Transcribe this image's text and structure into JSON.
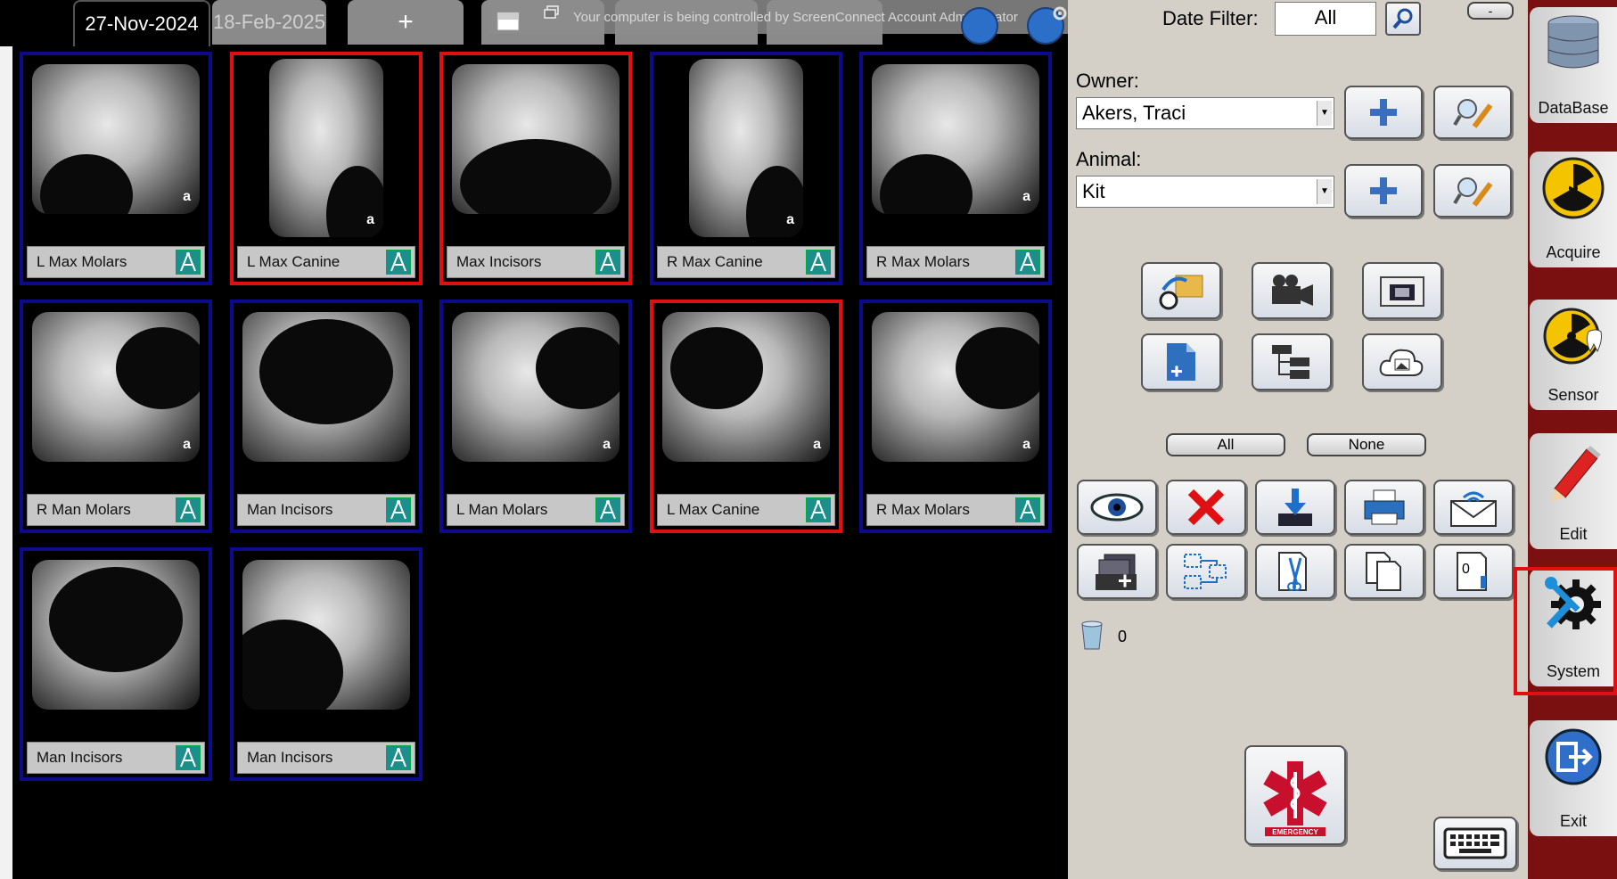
{
  "tabs": {
    "active": "27-Nov-2024",
    "inactive": "18-Feb-2025",
    "add": "+"
  },
  "screenconnect": {
    "banner": "Your computer is being controlled by ScreenConnect Account Administrator"
  },
  "thumbnails": [
    {
      "label": "L Max Molars",
      "selected": false,
      "mark": "a"
    },
    {
      "label": "L Max Canine",
      "selected": true,
      "mark": "a"
    },
    {
      "label": "Max Incisors",
      "selected": true,
      "mark": ""
    },
    {
      "label": "R Max Canine",
      "selected": false,
      "mark": "a"
    },
    {
      "label": "R Max Molars",
      "selected": false,
      "mark": "a"
    },
    {
      "label": "R Man Molars",
      "selected": false,
      "mark": "a"
    },
    {
      "label": "Man Incisors",
      "selected": false,
      "mark": ""
    },
    {
      "label": "L Man Molars",
      "selected": false,
      "mark": "a"
    },
    {
      "label": "L Max Canine",
      "selected": true,
      "mark": "a"
    },
    {
      "label": "R Max Molars",
      "selected": false,
      "mark": "a"
    },
    {
      "label": "Man Incisors",
      "selected": false,
      "mark": ""
    },
    {
      "label": "Man Incisors",
      "selected": false,
      "mark": ""
    }
  ],
  "panel": {
    "date_filter_label": "Date Filter:",
    "date_filter_value": "All",
    "minimize_label": "-",
    "owner_label": "Owner:",
    "owner_value": "Akers, Traci",
    "animal_label": "Animal:",
    "animal_value": "Kit",
    "all_button": "All",
    "none_button": "None",
    "page_counter": "0",
    "image_count": "0",
    "emergency_text": "EMERGENCY"
  },
  "sidebar": {
    "database": "DataBase",
    "acquire": "Acquire",
    "sensor": "Sensor",
    "edit": "Edit",
    "system": "System",
    "exit": "Exit"
  },
  "colors": {
    "selected_border": "#e01010",
    "thumb_border": "#0b0b8c",
    "label_icon": "#1c8f8c",
    "sidebar": "#7a1010",
    "panel": "#d4d0c8"
  }
}
